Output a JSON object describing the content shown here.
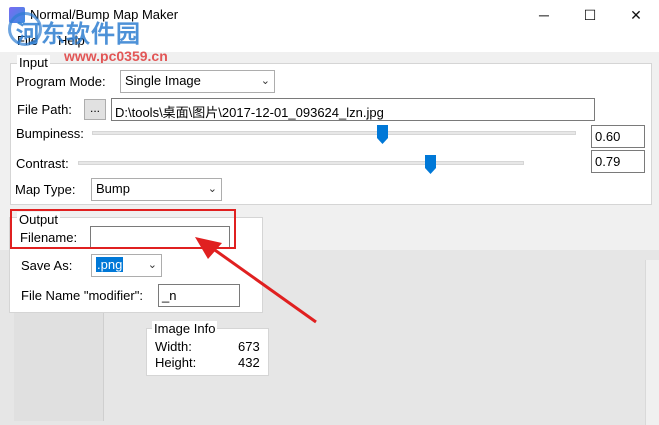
{
  "window": {
    "title": "Normal/Bump Map Maker",
    "minimize": "─",
    "maximize": "☐",
    "close": "✕"
  },
  "watermark": {
    "text": "河东软件园",
    "url": "www.pc0359.cn"
  },
  "menu": {
    "items": [
      "File",
      "Help"
    ]
  },
  "input": {
    "title": "Input",
    "program_mode_label": "Program Mode:",
    "program_mode_value": "Single Image",
    "file_path_label": "File Path:",
    "browse_label": "...",
    "file_path_value": "D:\\tools\\桌面\\图片\\2017-12-01_093624_lzn.jpg",
    "bumpiness_label": "Bumpiness:",
    "bumpiness_value": "0.60",
    "bumpiness_level": 0.6,
    "contrast_label": "Contrast:",
    "contrast_value": "0.79",
    "contrast_level": 0.79,
    "map_type_label": "Map Type:",
    "map_type_value": "Bump"
  },
  "output": {
    "title": "Output",
    "filename_label": "Filename:",
    "filename_value": "",
    "save_as_label": "Save As:",
    "save_as_value": ".png",
    "modifier_label": "File Name \"modifier\":",
    "modifier_value": "_n"
  },
  "image_info": {
    "title": "Image Info",
    "width_label": "Width:",
    "width_value": "673",
    "height_label": "Height:",
    "height_value": "432"
  },
  "colors": {
    "accent": "#0078d7",
    "highlight_border": "#e02020",
    "arrow": "#e02020",
    "selection": "#0078d7"
  }
}
